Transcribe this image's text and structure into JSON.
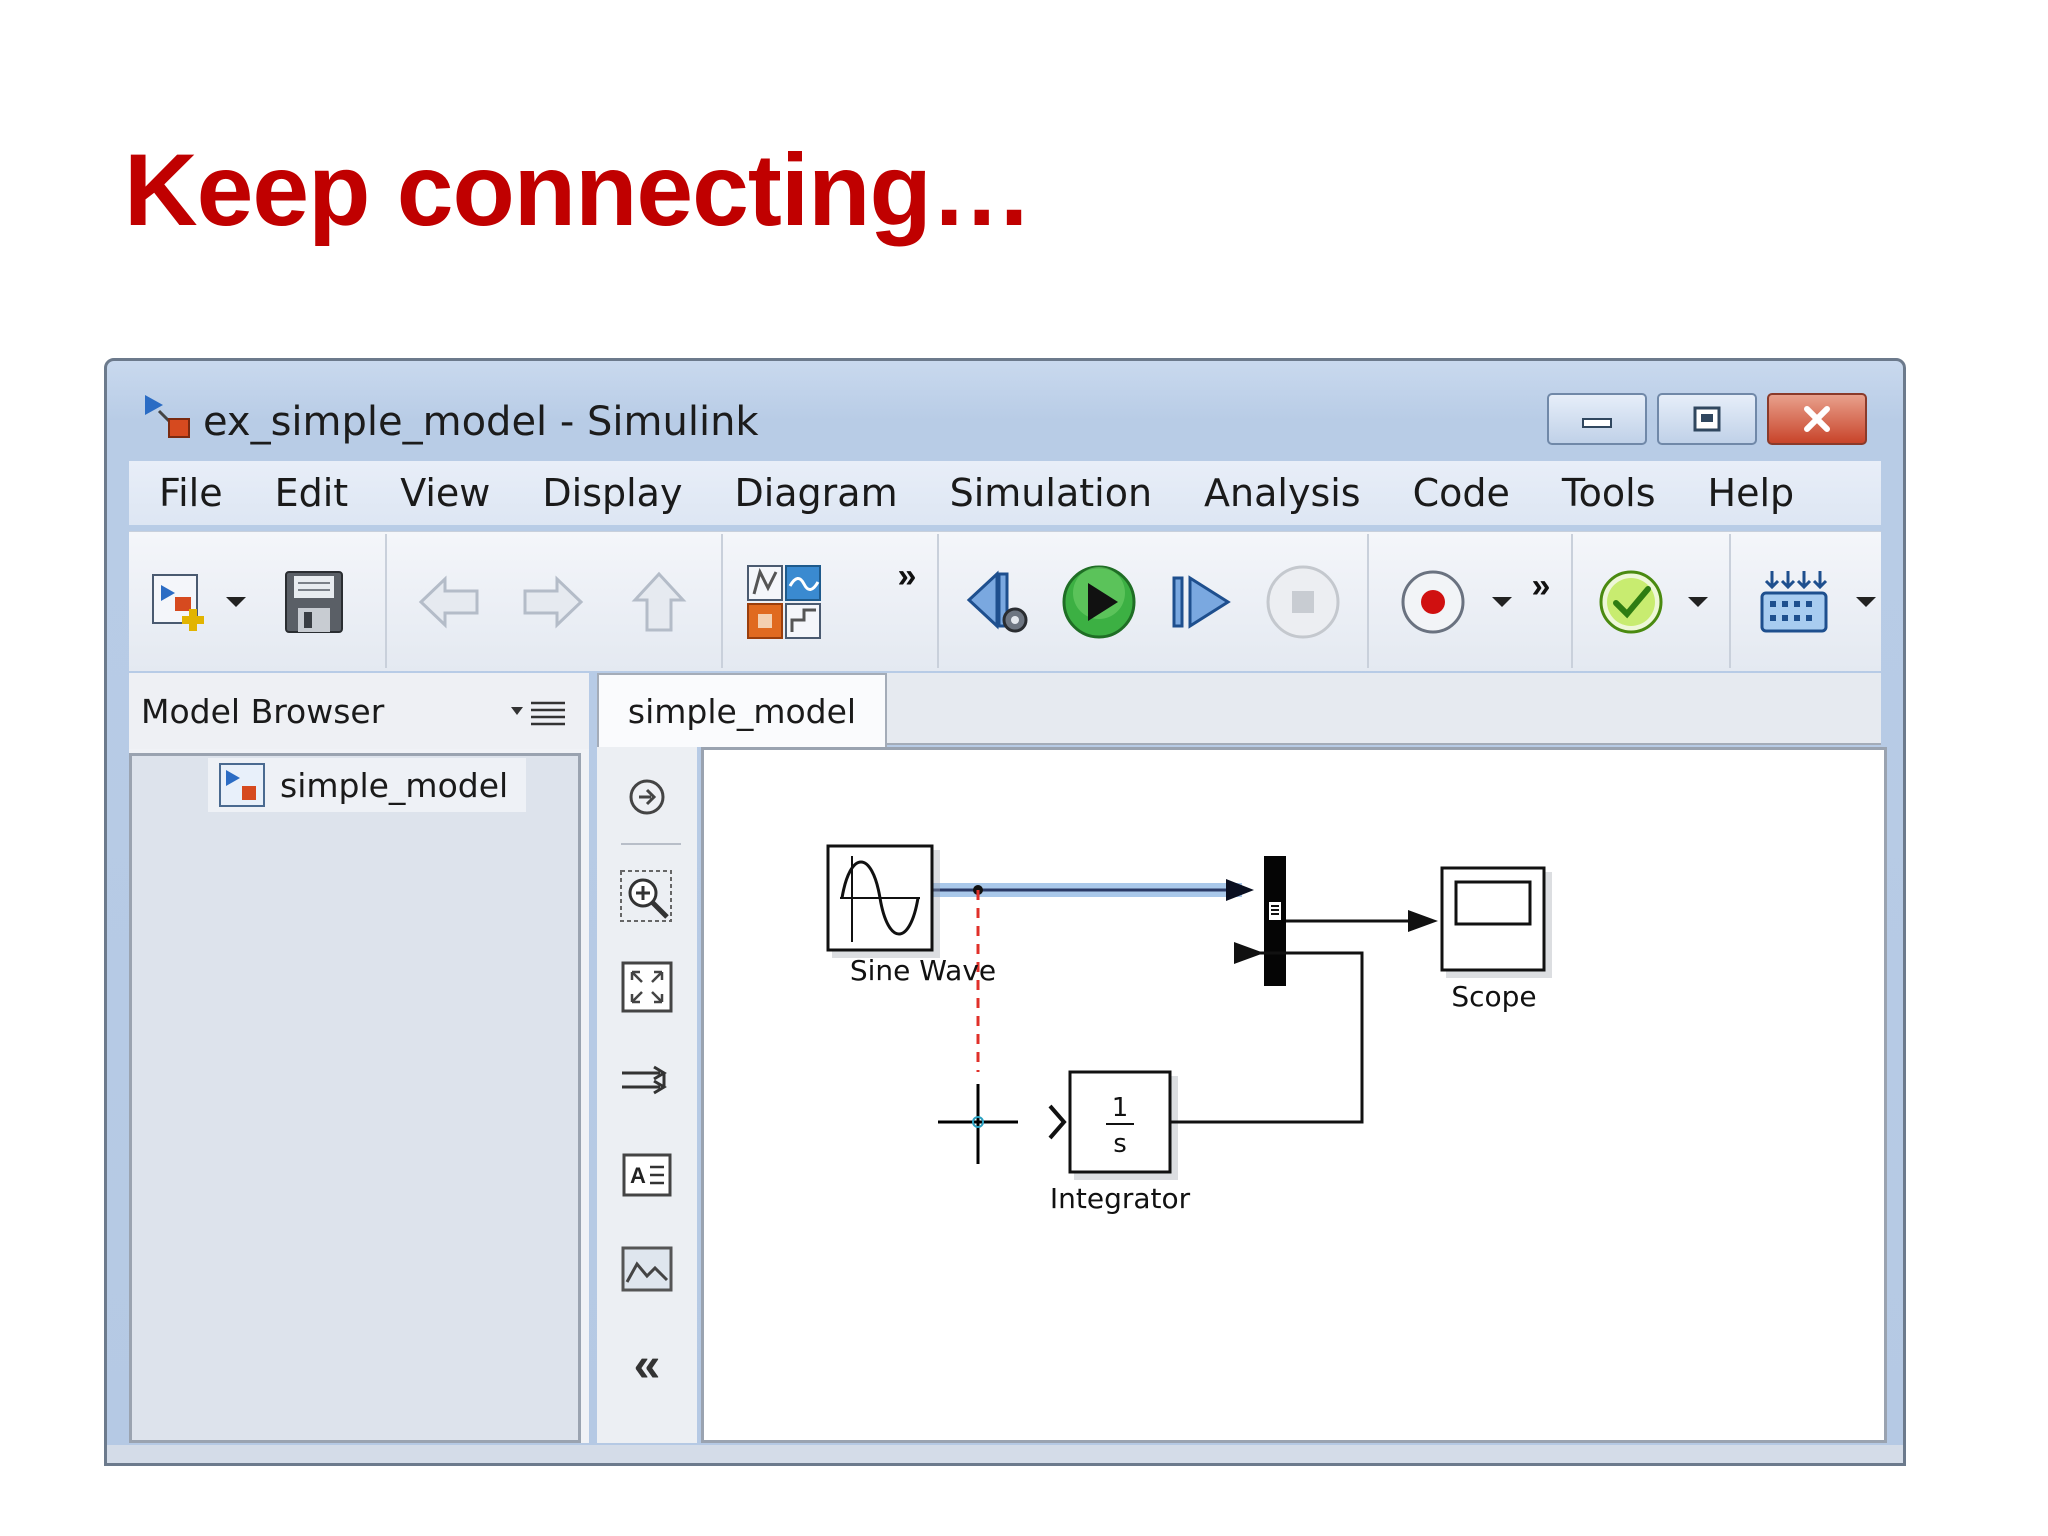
{
  "slide": {
    "title": "Keep connecting…"
  },
  "window": {
    "title": "ex_simple_model - Simulink",
    "controls": {
      "minimize": "minimize-icon",
      "maximize": "maximize-icon",
      "close": "close-icon"
    }
  },
  "menu": [
    "File",
    "Edit",
    "View",
    "Display",
    "Diagram",
    "Simulation",
    "Analysis",
    "Code",
    "Tools",
    "Help"
  ],
  "toolbar": {
    "icons": [
      "new-model-icon",
      "dropdown-arrow-icon",
      "save-icon",
      "back-icon",
      "forward-icon",
      "up-icon",
      "library-browser-icon",
      "overflow-icon",
      "step-back-icon",
      "run-icon",
      "step-forward-icon",
      "stop-icon",
      "record-icon",
      "dropdown-arrow-icon",
      "overflow-icon",
      "check-icon",
      "dropdown-arrow-icon",
      "hardware-icon",
      "dropdown-arrow-icon"
    ],
    "overflow": "»"
  },
  "browser": {
    "title": "Model Browser",
    "item": "simple_model"
  },
  "tab": {
    "label": "simple_model"
  },
  "palette": {
    "icons": [
      "navigate-icon",
      "zoom-icon",
      "fit-view-icon",
      "signal-route-icon",
      "annotation-icon",
      "image-icon",
      "collapse-icon"
    ],
    "collapse": "«"
  },
  "diagram": {
    "blocks": {
      "sine": "Sine Wave",
      "integrator": "Integrator",
      "integrator_num": "1",
      "integrator_den": "s",
      "scope": "Scope"
    },
    "colors": {
      "highlight_line": "#a9c8ea",
      "drag_line": "#e0302a",
      "cursor": "#000000"
    }
  },
  "colors": {
    "title_red": "#c00000",
    "window_frame": "#b8cce6",
    "run_green": "#3cb043",
    "record_red": "#d01010"
  }
}
